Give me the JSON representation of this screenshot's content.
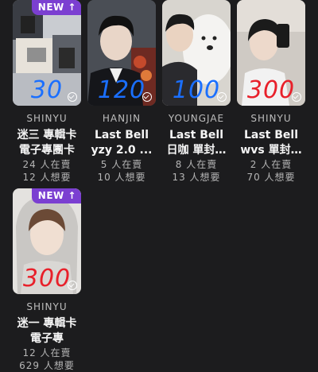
{
  "cards": [
    {
      "badge": "NEW ↑",
      "price": "30",
      "price_color": "#1a6fff",
      "artist": "SHINYU",
      "title_1": "迷三 專輯卡",
      "title_2": "電子專團卡",
      "stat_1": "24 人在賣",
      "stat_2": "12 人想要",
      "photo": "collage"
    },
    {
      "badge": "",
      "price": "120",
      "price_color": "#1a6fff",
      "artist": "HANJIN",
      "title_1": "Last Bell",
      "title_2": "yzy 2.0 ...",
      "stat_1": "5 人在賣",
      "stat_2": "10 人想要",
      "photo": "suit"
    },
    {
      "badge": "",
      "price": "100",
      "price_color": "#1a6fff",
      "artist": "YOUNGJAE",
      "title_1": "Last Bell",
      "title_2": "日咖 單封…",
      "stat_1": "8 人在賣",
      "stat_2": "13 人想要",
      "photo": "dog"
    },
    {
      "badge": "",
      "price": "300",
      "price_color": "#e8202a",
      "artist": "SHINYU",
      "title_1": "Last Bell",
      "title_2": "wvs 單封…",
      "stat_1": "2 人在賣",
      "stat_2": "70 人想要",
      "photo": "mirror"
    },
    {
      "badge": "NEW ↑",
      "price": "300",
      "price_color": "#e8202a",
      "artist": "SHINYU",
      "title_1": "迷一 專輯卡",
      "title_2": "電子專",
      "stat_1": "12 人在賣",
      "stat_2": "629 人想要",
      "photo": "hoodie"
    }
  ]
}
